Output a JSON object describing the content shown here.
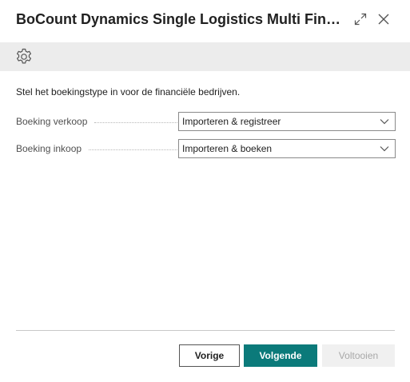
{
  "dialog": {
    "title": "BoCount Dynamics Single Logistics Multi Finan..."
  },
  "toolbar": {
    "settings_icon": "gear-icon"
  },
  "content": {
    "instruction": "Stel het boekingstype in voor de financiële bedrijven.",
    "fields": [
      {
        "label": "Boeking verkoop",
        "value": "Importeren & registreer"
      },
      {
        "label": "Boeking inkoop",
        "value": "Importeren & boeken"
      }
    ]
  },
  "footer": {
    "prev_label": "Vorige",
    "next_label": "Volgende",
    "finish_label": "Voltooien"
  },
  "colors": {
    "accent": "#0b7a7a",
    "toolbar_bg": "#ececec",
    "disabled_bg": "#f0f0f0"
  }
}
